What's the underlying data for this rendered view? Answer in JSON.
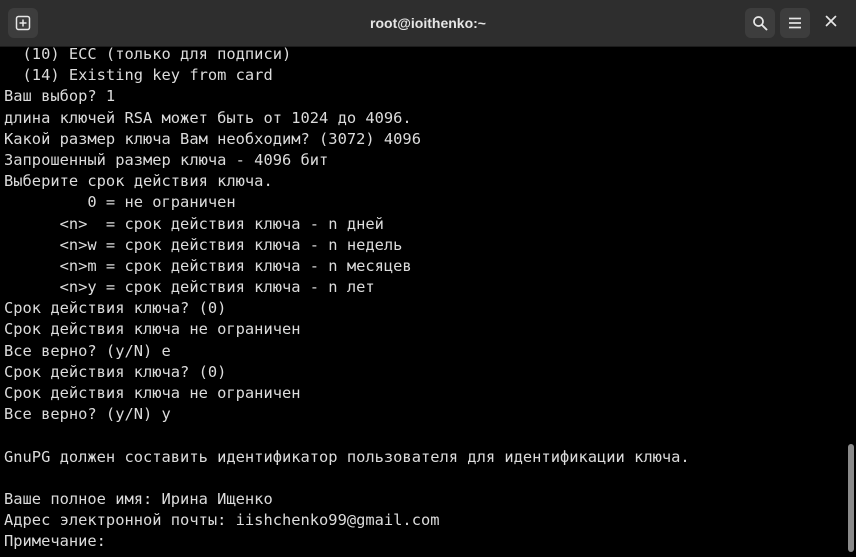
{
  "window": {
    "title": "root@ioithenko:~"
  },
  "icons": {
    "new_tab": "new-tab-icon",
    "search": "search-icon",
    "menu": "hamburger-menu-icon",
    "close": "close-icon"
  },
  "terminal": {
    "lines": [
      "  (10) ECC (только для подписи)",
      "  (14) Existing key from card",
      "Ваш выбор? 1",
      "длина ключей RSA может быть от 1024 до 4096.",
      "Какой размер ключа Вам необходим? (3072) 4096",
      "Запрошенный размер ключа - 4096 бит",
      "Выберите срок действия ключа.",
      "         0 = не ограничен",
      "      <n>  = срок действия ключа - n дней",
      "      <n>w = срок действия ключа - n недель",
      "      <n>m = срок действия ключа - n месяцев",
      "      <n>y = срок действия ключа - n лет",
      "Срок действия ключа? (0)",
      "Срок действия ключа не ограничен",
      "Все верно? (y/N) e",
      "Срок действия ключа? (0)",
      "Срок действия ключа не ограничен",
      "Все верно? (y/N) y",
      "",
      "GnuPG должен составить идентификатор пользователя для идентификации ключа.",
      "",
      "Ваше полное имя: Ирина Ищенко",
      "Адрес электронной почты: iishchenko99@gmail.com",
      "Примечание: "
    ]
  }
}
